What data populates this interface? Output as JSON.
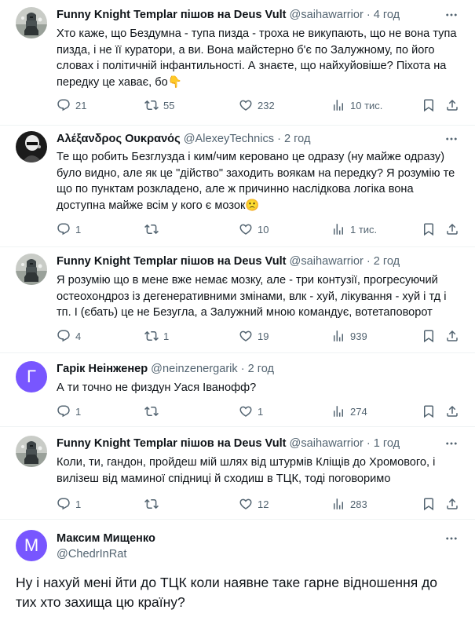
{
  "tweets": [
    {
      "name": "Funny Knight Templar пішов на Deus Vult",
      "handle": "@saihawarrior",
      "time": "4 год",
      "text": "Хто каже, що Бездумна - тупа пизда - троха не викупають, що не вона тупа пизда, і не її куратори, а ви. Вона майстерно б'є по Залужному, по його словах і політичній інфантильності. А знаєте, що найхуйовіше? Піхота на передку це хаває, бо👇",
      "replies": "21",
      "retweets": "55",
      "likes": "232",
      "views": "10 тис."
    },
    {
      "name": "Αλέξανδρος Ουκρανός",
      "handle": "@AlexeyTechnics",
      "time": "2 год",
      "text": "Те що робить Безглузда і ким/чим керовано це одразу (ну майже одразу) було видно, але як це \"дійство\" заходить воякам на передку? Я розумію те що по пунктам розкладено, але ж причинно наслідкова логіка вона доступна майже всім у кого є мозок🙁",
      "replies": "1",
      "retweets": "",
      "likes": "10",
      "views": "1 тис."
    },
    {
      "name": "Funny Knight Templar пішов на Deus Vult",
      "handle": "@saihawarrior",
      "time": "2 год",
      "text": "Я розумію що в мене вже немає мозку, але - три контузії, прогресуючий остеохондроз із дегенеративними змінами, влк - хуй, лікування - хуй і тд і тп. І (єбать) це не Безугла, а Залужний мною командує, вотетаповорот",
      "replies": "4",
      "retweets": "1",
      "likes": "19",
      "views": "939"
    },
    {
      "name": "Гарік Неінженер",
      "handle": "@neinzenergarik",
      "time": "2 год",
      "avatar_letter": "Г",
      "avatar_color": "#7856ff",
      "text": "А ти точно не физдун Уася Іванофф?",
      "replies": "1",
      "retweets": "",
      "likes": "1",
      "views": "274"
    },
    {
      "name": "Funny Knight Templar пішов на Deus Vult",
      "handle": "@saihawarrior",
      "time": "1 год",
      "text": "Коли, ти, гандон, пройдеш мій шлях від штурмів Кліщів до Хромового, і вилізеш від маминої спідниці й сходиш в ТЦК, тоді поговоримо",
      "replies": "1",
      "retweets": "",
      "likes": "12",
      "views": "283"
    }
  ],
  "main_tweet": {
    "name": "Максим Мищенко",
    "handle": "@ChedrInRat",
    "avatar_letter": "М",
    "avatar_color": "#7856ff",
    "text": "Ну і нахуй мені йти до ТЦК коли наявне таке гарне відношення до тих хто захища цю країну?"
  },
  "colors": {
    "text_primary": "#0f1419",
    "text_secondary": "#536471",
    "divider": "#eff3f4",
    "avatar_purple": "#7856ff"
  }
}
